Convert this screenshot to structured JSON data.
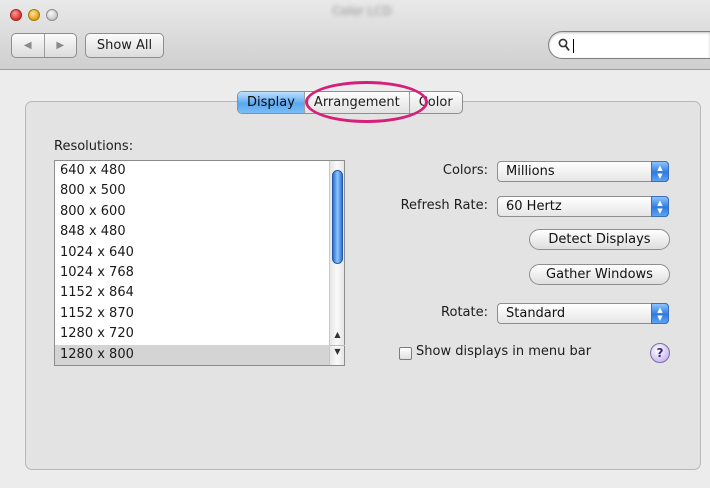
{
  "window": {
    "title": "Color LCD"
  },
  "toolbar": {
    "back_glyph": "◀",
    "forward_glyph": "▶",
    "show_all_label": "Show All",
    "search_value": ""
  },
  "tabs": [
    {
      "label": "Display",
      "active": true
    },
    {
      "label": "Arrangement",
      "active": false
    },
    {
      "label": "Color",
      "active": false
    }
  ],
  "resolutions": {
    "label": "Resolutions:",
    "items": [
      "640 x 480",
      "800 x 500",
      "800 x 600",
      "848 x 480",
      "1024 x 640",
      "1024 x 768",
      "1152 x 864",
      "1152 x 870",
      "1280 x 720",
      "1280 x 800"
    ],
    "selected": "1280 x 800"
  },
  "controls": {
    "colors_label": "Colors:",
    "colors_value": "Millions",
    "refresh_label": "Refresh Rate:",
    "refresh_value": "60 Hertz",
    "detect_label": "Detect Displays",
    "gather_label": "Gather Windows",
    "rotate_label": "Rotate:",
    "rotate_value": "Standard",
    "menu_bar_checkbox_label": "Show displays in menu bar",
    "menu_bar_checked": false,
    "help_glyph": "?"
  },
  "annotation": {
    "highlight_color": "#d61f7a"
  }
}
